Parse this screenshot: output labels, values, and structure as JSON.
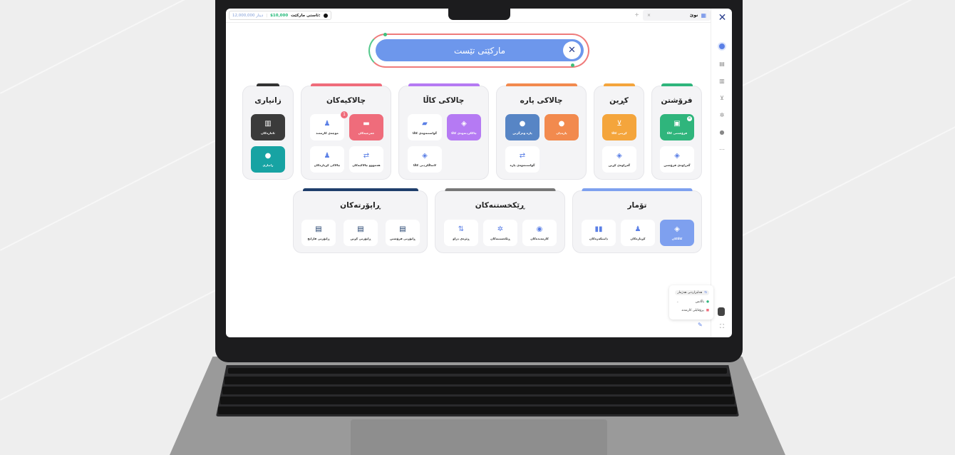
{
  "topbar": {
    "tab_label": "نوێ",
    "tab_close": "×",
    "tab_add": "+",
    "market_price_label": "ئاستی مارکێت:",
    "market_usd": "$10,000",
    "market_iqd": "12,000,000 دینار"
  },
  "search": {
    "label": "مارکێتی تێست"
  },
  "sections": {
    "sales": {
      "title": "فرۆشتن",
      "color": "#2fb57c",
      "tiles": [
        "فرۆشتنی کاڵا",
        "گەڕاوەی فرۆشتن"
      ]
    },
    "purchase": {
      "title": "کڕین",
      "color": "#f4a53c",
      "tiles": [
        "کڕینی کاڵا",
        "گەڕاوەی کڕین"
      ]
    },
    "money": {
      "title": "چالاکی پارە",
      "color": "#f28a4e",
      "tiles": [
        "پارەدان",
        "پارە وەرگرتن",
        "گواستنەوەی پارە"
      ]
    },
    "goods": {
      "title": "چالاکی کاڵا",
      "color": "#b57af3",
      "tiles": [
        "چاککردنەوەی کاڵا",
        "گواستنەوەی کاڵا",
        "لاساڵکردنی کاڵا"
      ]
    },
    "activities": {
      "title": "چالاکیەکان",
      "color": "#ef6c7b",
      "tiles": [
        "خەرجیەکان",
        "موچەی کارمەند",
        "هەمووو چالاکیەکان",
        "چالاکی کڕیارەکان"
      ],
      "badge": "1"
    },
    "info": {
      "title": "زانیاری",
      "color": "#333333",
      "tiles": [
        "ئامارەکان",
        "زانیاری"
      ]
    },
    "records": {
      "title": "تۆمار",
      "color": "#7ea0ef",
      "tiles": [
        "کاڵاکان",
        "کڕیارەکان",
        "دابینکەرەکان"
      ]
    },
    "settings": {
      "title": "ڕێکخستنەکان",
      "color": "#777777",
      "tiles": [
        "کارمەندەکان",
        "ڕێکخستنەکان",
        "ڕێژەی دراو"
      ]
    },
    "reports": {
      "title": "ڕاپۆرتەکان",
      "color": "#1f3e6b",
      "tiles": [
        "ڕاپۆرتی فرۆشتن",
        "ڕاپۆرتی کڕین",
        "ڕاپۆرتی قازانج"
      ]
    }
  },
  "popup": {
    "items": [
      "هەلبژاردنی هەژمار",
      "باڵانس",
      "پرۆڤایلی کارمەند"
    ]
  },
  "icons": {
    "logo": "x-logo-icon",
    "sidebar": [
      "home-icon",
      "document-icon",
      "chart-icon",
      "cart-icon",
      "gear-icon",
      "help-icon",
      "more-icon"
    ]
  }
}
